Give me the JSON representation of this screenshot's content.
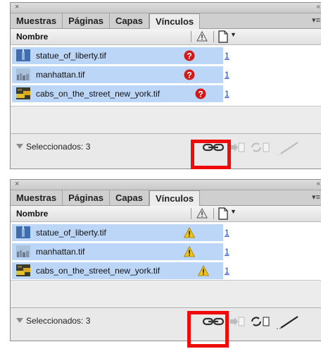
{
  "panel_top": {
    "close": "×",
    "collapse": "«",
    "tabs": [
      "Muestras",
      "Páginas",
      "Capas",
      "Vínculos"
    ],
    "active_tab": "Vínculos",
    "menu": "▾≡",
    "column_name": "Nombre",
    "rows": [
      {
        "name": "statue_of_liberty.tif",
        "status": "missing",
        "page": "1"
      },
      {
        "name": "manhattan.tif",
        "status": "missing",
        "page": "1"
      },
      {
        "name": "cabs_on_the_street_new_york.tif",
        "status": "missing",
        "page": "1"
      }
    ],
    "footer_status": "Seleccionados: 3"
  },
  "panel_bottom": {
    "close": "×",
    "collapse": "«",
    "tabs": [
      "Muestras",
      "Páginas",
      "Capas",
      "Vínculos"
    ],
    "active_tab": "Vínculos",
    "menu": "▾≡",
    "column_name": "Nombre",
    "rows": [
      {
        "name": "statue_of_liberty.tif",
        "status": "modified",
        "page": "1"
      },
      {
        "name": "manhattan.tif",
        "status": "modified",
        "page": "1"
      },
      {
        "name": "cabs_on_the_street_new_york.tif",
        "status": "modified",
        "page": "1"
      }
    ],
    "footer_status": "Seleccionados: 3"
  },
  "icons": {
    "missing": "question-circle-icon",
    "modified": "warning-triangle-icon",
    "relink": "relink-chain-icon",
    "goto": "go-to-link-icon",
    "update": "update-link-icon",
    "edit": "edit-original-icon"
  },
  "colors": {
    "selection": "#bcd6f7",
    "highlight_box": "#ee0b0b",
    "missing": "#d21a1a",
    "warning": "#f2c418"
  }
}
